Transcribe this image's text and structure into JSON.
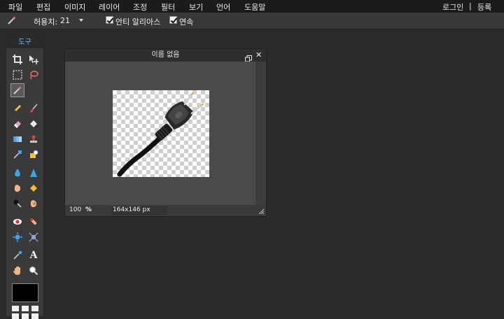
{
  "menu": {
    "items": [
      "파일",
      "편집",
      "이미지",
      "레이어",
      "조정",
      "필터",
      "보기",
      "언어",
      "도움말"
    ],
    "login": "로그인",
    "separator": "|",
    "register": "등록"
  },
  "options": {
    "tolerance_label": "허용치:",
    "tolerance_value": "21",
    "antialias_label": "안티 알리아스",
    "contiguous_label": "연속"
  },
  "tools": {
    "title": "도구",
    "icons": [
      "crop-icon",
      "move-icon",
      "marquee-icon",
      "lasso-icon",
      "magic-wand-icon",
      "pencil-icon",
      "brush-icon",
      "eraser-icon",
      "paint-bucket-icon",
      "gradient-icon",
      "clone-stamp-icon",
      "color-replace-icon",
      "drawing-icon",
      "blur-icon",
      "sharpen-icon",
      "smudge-icon",
      "sponge-icon",
      "dodge-icon",
      "burn-icon",
      "red-eye-icon",
      "spot-heal-icon",
      "bloat-icon",
      "pinch-icon",
      "color-picker-icon",
      "type-icon",
      "hand-icon",
      "zoom-icon"
    ],
    "type_glyph": "A"
  },
  "document": {
    "title": "이름 없음",
    "close_glyph": "✕",
    "zoom": "100",
    "zoom_unit": "%",
    "dimensions": "164x146 px"
  },
  "colors": {
    "foreground": "#000000",
    "accent": "#69b6ff"
  }
}
